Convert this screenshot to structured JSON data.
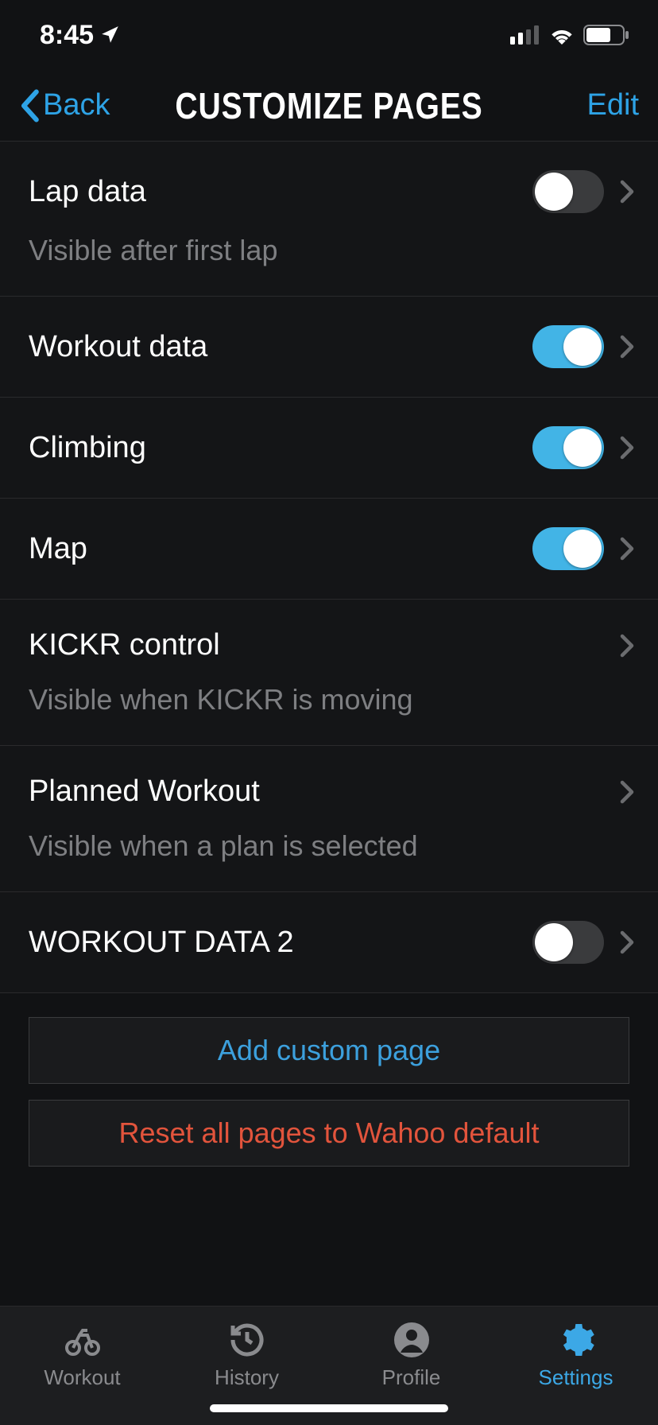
{
  "status": {
    "time": "8:45"
  },
  "nav": {
    "back": "Back",
    "title": "CUSTOMIZE PAGES",
    "edit": "Edit"
  },
  "rows": [
    {
      "label": "Lap data",
      "sub": "Visible after first lap",
      "toggle": "off"
    },
    {
      "label": "Workout data",
      "toggle": "on"
    },
    {
      "label": "Climbing",
      "toggle": "on"
    },
    {
      "label": "Map",
      "toggle": "on"
    },
    {
      "label": "KICKR control",
      "sub": "Visible when KICKR is moving"
    },
    {
      "label": "Planned Workout",
      "sub": "Visible when a plan is selected"
    },
    {
      "label": "WORKOUT DATA 2",
      "toggle": "off"
    }
  ],
  "actions": {
    "add": "Add custom page",
    "reset": "Reset all pages to Wahoo default"
  },
  "tabs": [
    {
      "label": "Workout"
    },
    {
      "label": "History"
    },
    {
      "label": "Profile"
    },
    {
      "label": "Settings"
    }
  ]
}
